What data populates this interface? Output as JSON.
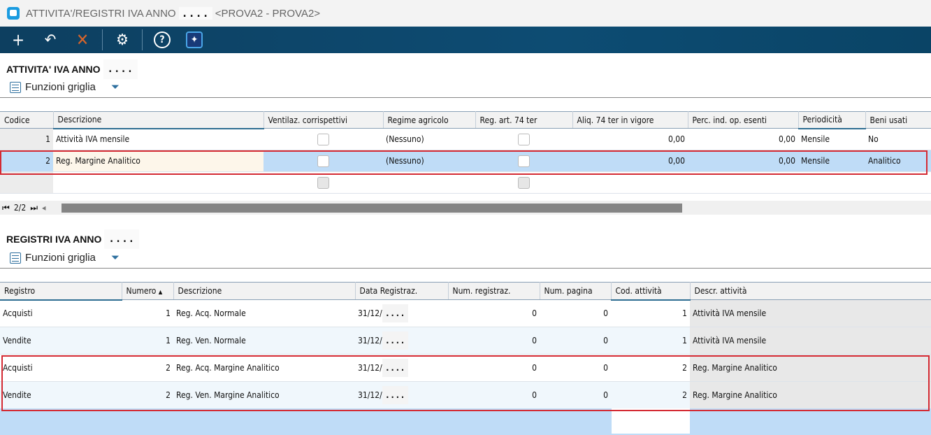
{
  "window": {
    "title": "ATTIVITA'/REGISTRI IVA ANNO",
    "year_mask": "....",
    "company": "<PROVA2 - PROVA2>"
  },
  "toolbar": {
    "icons": [
      "plus-icon",
      "undo-icon",
      "close-icon",
      "gear-icon",
      "help-icon",
      "ai-sparkle-icon"
    ]
  },
  "activities": {
    "title": "ATTIVITA' IVA ANNO",
    "year_mask": "....",
    "grid_functions": "Funzioni griglia",
    "columns": [
      "Codice",
      "Descrizione",
      "Ventilaz. corrispettivi",
      "Regime agricolo",
      "Reg. art. 74 ter",
      "Aliq. 74 ter in vigore",
      "Perc. ind. op. esenti",
      "Periodicità",
      "Beni usati"
    ],
    "rows": [
      {
        "codice": "1",
        "descrizione": "Attività IVA mensile",
        "ventilaz": false,
        "regime": "(Nessuno)",
        "reg74": false,
        "aliq": "0,00",
        "perc": "0,00",
        "periodicita": "Mensile",
        "beni": "No"
      },
      {
        "codice": "2",
        "descrizione": "Reg. Margine Analitico",
        "ventilaz": false,
        "regime": "(Nessuno)",
        "reg74": false,
        "aliq": "0,00",
        "perc": "0,00",
        "periodicita": "Mensile",
        "beni": "Analitico"
      }
    ],
    "pager": "2/2"
  },
  "registers": {
    "title": "REGISTRI IVA ANNO",
    "year_mask": "....",
    "grid_functions": "Funzioni griglia",
    "columns": [
      "Registro",
      "Numero",
      "Descrizione",
      "Data Registraz.",
      "Num. registraz.",
      "Num. pagina",
      "Cod. attività",
      "Descr. attività"
    ],
    "sort_indicator": "▲",
    "rows": [
      {
        "registro": "Acquisti",
        "numero": "1",
        "descrizione": "Reg. Acq. Normale",
        "data": "31/12/",
        "data_mask": "....",
        "num_reg": "0",
        "num_pag": "0",
        "cod": "1",
        "descr": "Attività IVA mensile"
      },
      {
        "registro": "Vendite",
        "numero": "1",
        "descrizione": "Reg. Ven. Normale",
        "data": "31/12/",
        "data_mask": "....",
        "num_reg": "0",
        "num_pag": "0",
        "cod": "1",
        "descr": "Attività IVA mensile"
      },
      {
        "registro": "Acquisti",
        "numero": "2",
        "descrizione": "Reg. Acq. Margine Analitico",
        "data": "31/12/",
        "data_mask": "....",
        "num_reg": "0",
        "num_pag": "0",
        "cod": "2",
        "descr": "Reg. Margine Analitico"
      },
      {
        "registro": "Vendite",
        "numero": "2",
        "descrizione": "Reg. Ven. Margine Analitico",
        "data": "31/12/",
        "data_mask": "....",
        "num_reg": "0",
        "num_pag": "0",
        "cod": "2",
        "descr": "Reg. Margine Analitico"
      }
    ]
  },
  "colors": {
    "highlight": "#d42a33",
    "selected_row": "#bfdcf7",
    "toolbar": "#0d4c73"
  }
}
